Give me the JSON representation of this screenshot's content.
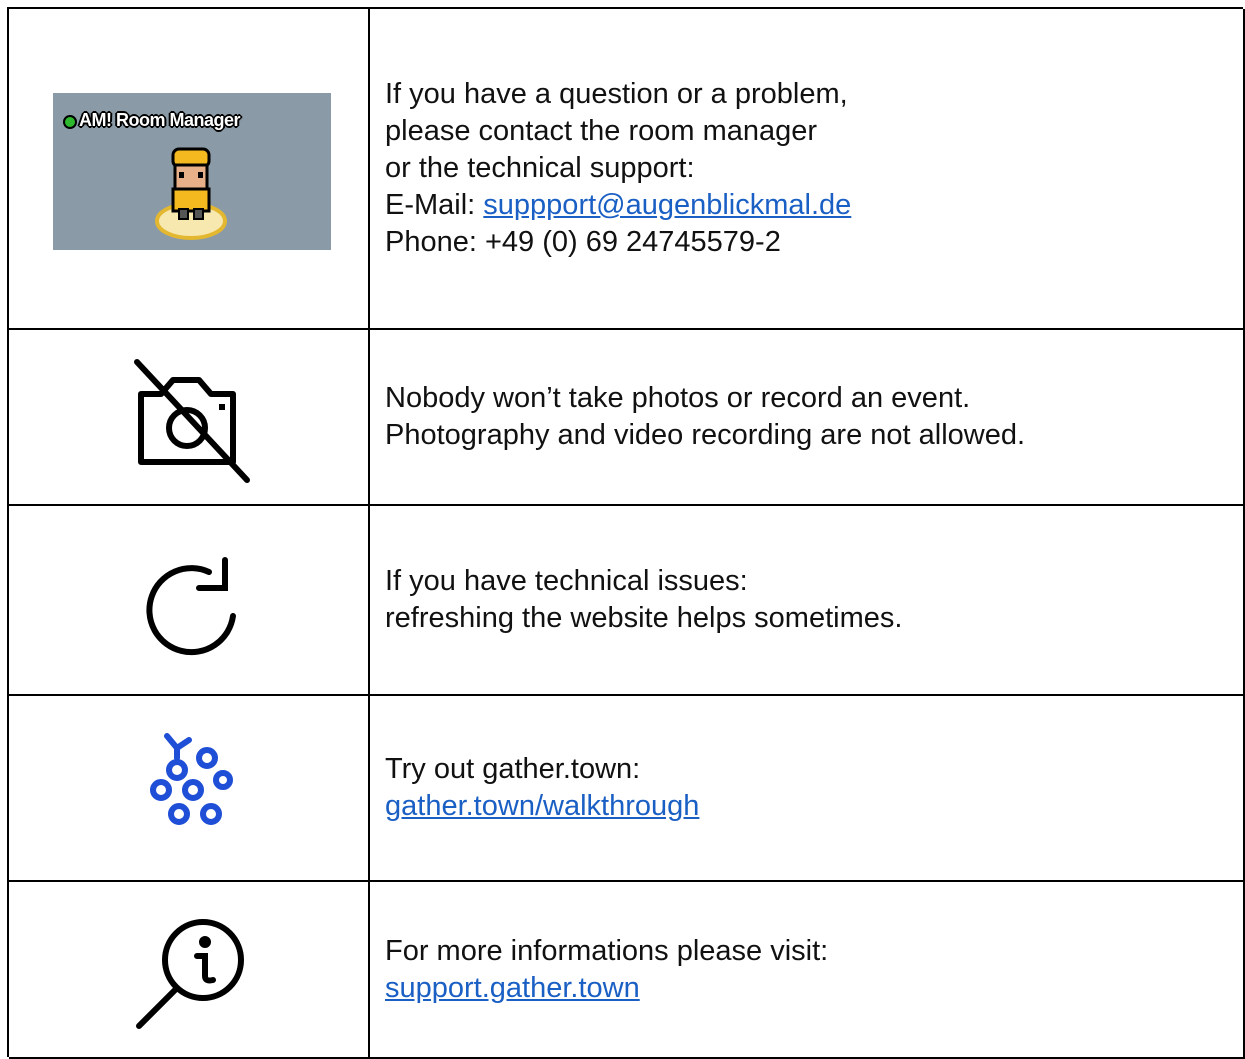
{
  "rows": [
    {
      "icon": "room-manager-avatar",
      "badge_label": "AM! Room Manager",
      "lines": [
        "If you have a question or a problem,",
        "please contact the room manager",
        "or the technical support:"
      ],
      "email_label": "E-Mail: ",
      "email_link": "suppport@augenblickmal.de",
      "phone": "Phone: +49 (0) 69 24745579-2"
    },
    {
      "icon": "no-camera-icon",
      "lines": [
        "Nobody won’t take photos or record an event.",
        "Photography and video recording are not allowed."
      ]
    },
    {
      "icon": "refresh-icon",
      "lines": [
        "If you have technical issues:",
        "refreshing the website helps sometimes."
      ]
    },
    {
      "icon": "gather-logo-icon",
      "lines": [
        "Try out gather.town:"
      ],
      "link": "gather.town/walkthrough"
    },
    {
      "icon": "info-search-icon",
      "lines": [
        "For more informations please visit:"
      ],
      "link": "support.gather.town"
    }
  ],
  "colors": {
    "link": "#1a5fc4",
    "gather_blue": "#1f4fd6",
    "badge_bg": "#8a9aa6"
  }
}
